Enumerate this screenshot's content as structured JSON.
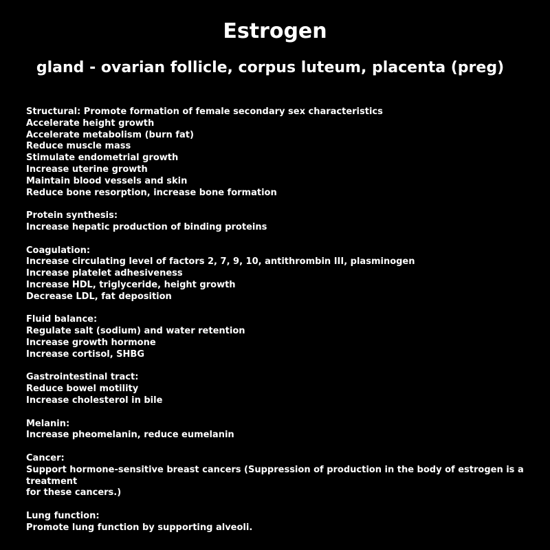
{
  "title": "Estrogen",
  "subtitle": "gland - ovarian follicle, corpus luteum, placenta (preg)",
  "sections": [
    {
      "lines": [
        "Structural: Promote formation of female secondary sex characteristics",
        "Accelerate height growth",
        "Accelerate metabolism (burn fat)",
        "Reduce muscle mass",
        "Stimulate endometrial growth",
        "Increase uterine growth",
        "Maintain blood vessels and skin",
        "Reduce bone resorption, increase bone formation"
      ]
    },
    {
      "lines": [
        "Protein synthesis:",
        "Increase hepatic production of binding proteins"
      ]
    },
    {
      "lines": [
        "Coagulation:",
        "Increase circulating level of factors 2, 7, 9, 10, antithrombin III, plasminogen",
        "Increase platelet adhesiveness",
        "Increase HDL, triglyceride, height growth",
        "Decrease LDL, fat deposition"
      ]
    },
    {
      "lines": [
        "Fluid balance:",
        "Regulate salt (sodium) and water retention",
        "Increase growth hormone",
        "Increase cortisol, SHBG"
      ]
    },
    {
      "lines": [
        "Gastrointestinal tract:",
        "Reduce bowel motility",
        "Increase cholesterol in bile"
      ]
    },
    {
      "lines": [
        "Melanin:",
        "Increase pheomelanin, reduce eumelanin"
      ]
    },
    {
      "lines": [
        "Cancer:",
        "Support hormone-sensitive breast cancers (Suppression of production in the body of estrogen is a treatment",
        "for these cancers.)"
      ]
    },
    {
      "lines": [
        "Lung function:",
        "Promote lung function by supporting alveoli."
      ]
    }
  ]
}
